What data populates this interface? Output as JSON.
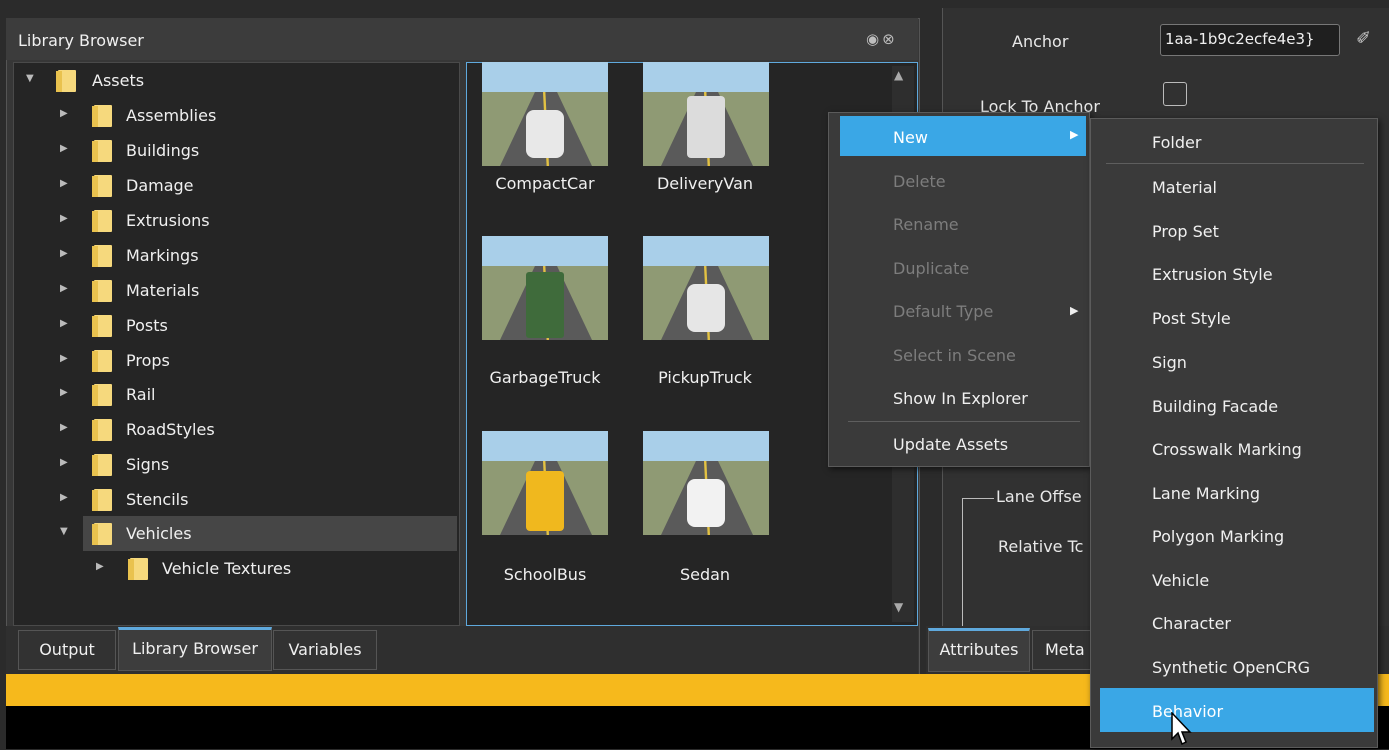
{
  "library_browser": {
    "title": "Library Browser",
    "header_icons": [
      "pin-icon",
      "close-icon"
    ],
    "tree": [
      {
        "label": "Assets",
        "level": 0,
        "expanded": true
      },
      {
        "label": "Assemblies",
        "level": 1
      },
      {
        "label": "Buildings",
        "level": 1
      },
      {
        "label": "Damage",
        "level": 1
      },
      {
        "label": "Extrusions",
        "level": 1
      },
      {
        "label": "Markings",
        "level": 1
      },
      {
        "label": "Materials",
        "level": 1
      },
      {
        "label": "Posts",
        "level": 1
      },
      {
        "label": "Props",
        "level": 1
      },
      {
        "label": "Rail",
        "level": 1
      },
      {
        "label": "RoadStyles",
        "level": 1
      },
      {
        "label": "Signs",
        "level": 1
      },
      {
        "label": "Stencils",
        "level": 1
      },
      {
        "label": "Vehicles",
        "level": 1,
        "expanded": true,
        "selected": true
      },
      {
        "label": "Vehicle Textures",
        "level": 2
      }
    ],
    "assets": [
      {
        "label": "CompactCar",
        "color": "#e8e8e8"
      },
      {
        "label": "DeliveryVan",
        "color": "#dcdcdc"
      },
      {
        "label": "GarbageTruck",
        "color": "#3f6b3b"
      },
      {
        "label": "PickupTruck",
        "color": "#e6e6e6"
      },
      {
        "label": "SchoolBus",
        "color": "#f0b81e"
      },
      {
        "label": "Sedan",
        "color": "#f2f2f2"
      }
    ]
  },
  "bottom_tabs": [
    {
      "label": "Output",
      "active": false
    },
    {
      "label": "Library Browser",
      "active": true
    },
    {
      "label": "Variables",
      "active": false
    }
  ],
  "attributes": {
    "anchor_label": "Anchor",
    "anchor_value": "1aa-1b9c2ecfe4e3}",
    "lock_label": "Lock To Anchor",
    "lane_offset_label": "Lane Offse",
    "relative_to_label": "Relative Tc",
    "tabs": [
      {
        "label": "Attributes",
        "active": true
      },
      {
        "label": "Meta",
        "active": false
      }
    ]
  },
  "context_menu": {
    "items": [
      {
        "label": "New",
        "enabled": true,
        "highlighted": true,
        "submenu": true
      },
      {
        "label": "Delete",
        "enabled": false
      },
      {
        "label": "Rename",
        "enabled": false
      },
      {
        "label": "Duplicate",
        "enabled": false
      },
      {
        "label": "Default Type",
        "enabled": false,
        "submenu": true
      },
      {
        "label": "Select in Scene",
        "enabled": false
      },
      {
        "label": "Show In Explorer",
        "enabled": true
      },
      {
        "label": "Update Assets",
        "enabled": true
      }
    ]
  },
  "new_submenu": {
    "items": [
      {
        "label": "Folder"
      },
      {
        "label": "Material"
      },
      {
        "label": "Prop Set"
      },
      {
        "label": "Extrusion Style"
      },
      {
        "label": "Post Style"
      },
      {
        "label": "Sign"
      },
      {
        "label": "Building Facade"
      },
      {
        "label": "Crosswalk Marking"
      },
      {
        "label": "Lane Marking"
      },
      {
        "label": "Polygon Marking"
      },
      {
        "label": "Vehicle"
      },
      {
        "label": "Character"
      },
      {
        "label": "Synthetic OpenCRG"
      },
      {
        "label": "Behavior",
        "highlighted": true
      }
    ]
  },
  "colors": {
    "accent": "#3aa7e6",
    "status_bar": "#f6b91c",
    "folder": "#f6d97d"
  }
}
